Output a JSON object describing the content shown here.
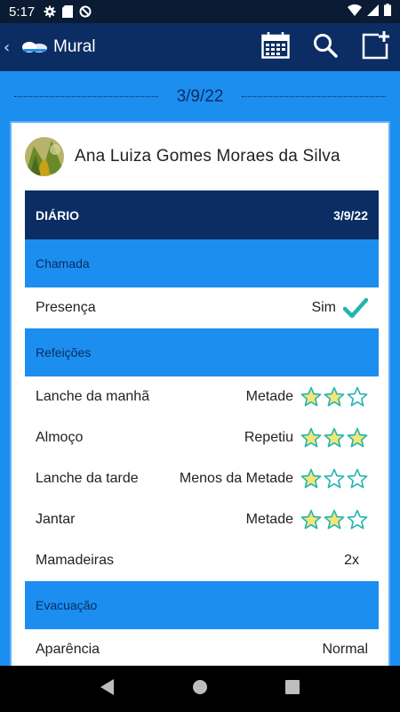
{
  "status_bar": {
    "time": "5:17"
  },
  "app_bar": {
    "title": "Mural"
  },
  "date_divider": "3/9/22",
  "student": {
    "name": "Ana Luiza Gomes Moraes da Silva"
  },
  "diary": {
    "title": "DIÁRIO",
    "date": "3/9/22",
    "sections": {
      "chamada": {
        "label": "Chamada",
        "presenca_label": "Presença",
        "presenca_value": "Sim"
      },
      "refeicoes": {
        "label": "Refeições",
        "rows": [
          {
            "label": "Lanche da manhã",
            "value": "Metade",
            "rating": 2,
            "max": 3
          },
          {
            "label": "Almoço",
            "value": "Repetiu",
            "rating": 3,
            "max": 3
          },
          {
            "label": "Lanche da tarde",
            "value": "Menos da Metade",
            "rating": 1,
            "max": 3
          },
          {
            "label": "Jantar",
            "value": "Metade",
            "rating": 2,
            "max": 3
          }
        ],
        "mamadeiras_label": "Mamadeiras",
        "mamadeiras_value": "2x"
      },
      "evacuacao": {
        "label": "Evacuação",
        "aparencia_label": "Aparência",
        "aparencia_value": "Normal"
      }
    }
  },
  "colors": {
    "primary_dark": "#0b2d63",
    "primary": "#1c8ef0",
    "star_fill": "#f3e57a",
    "star_outline": "#22b5b0",
    "check": "#22b5b0"
  },
  "icons": [
    "settings-icon",
    "sd-card-icon",
    "no-disturb-icon",
    "wifi-icon",
    "signal-icon",
    "battery-icon",
    "back-chevron-icon",
    "calendar-icon",
    "search-icon",
    "new-post-icon",
    "check-icon",
    "star-icon",
    "nav-back-icon",
    "nav-home-icon",
    "nav-recents-icon"
  ]
}
